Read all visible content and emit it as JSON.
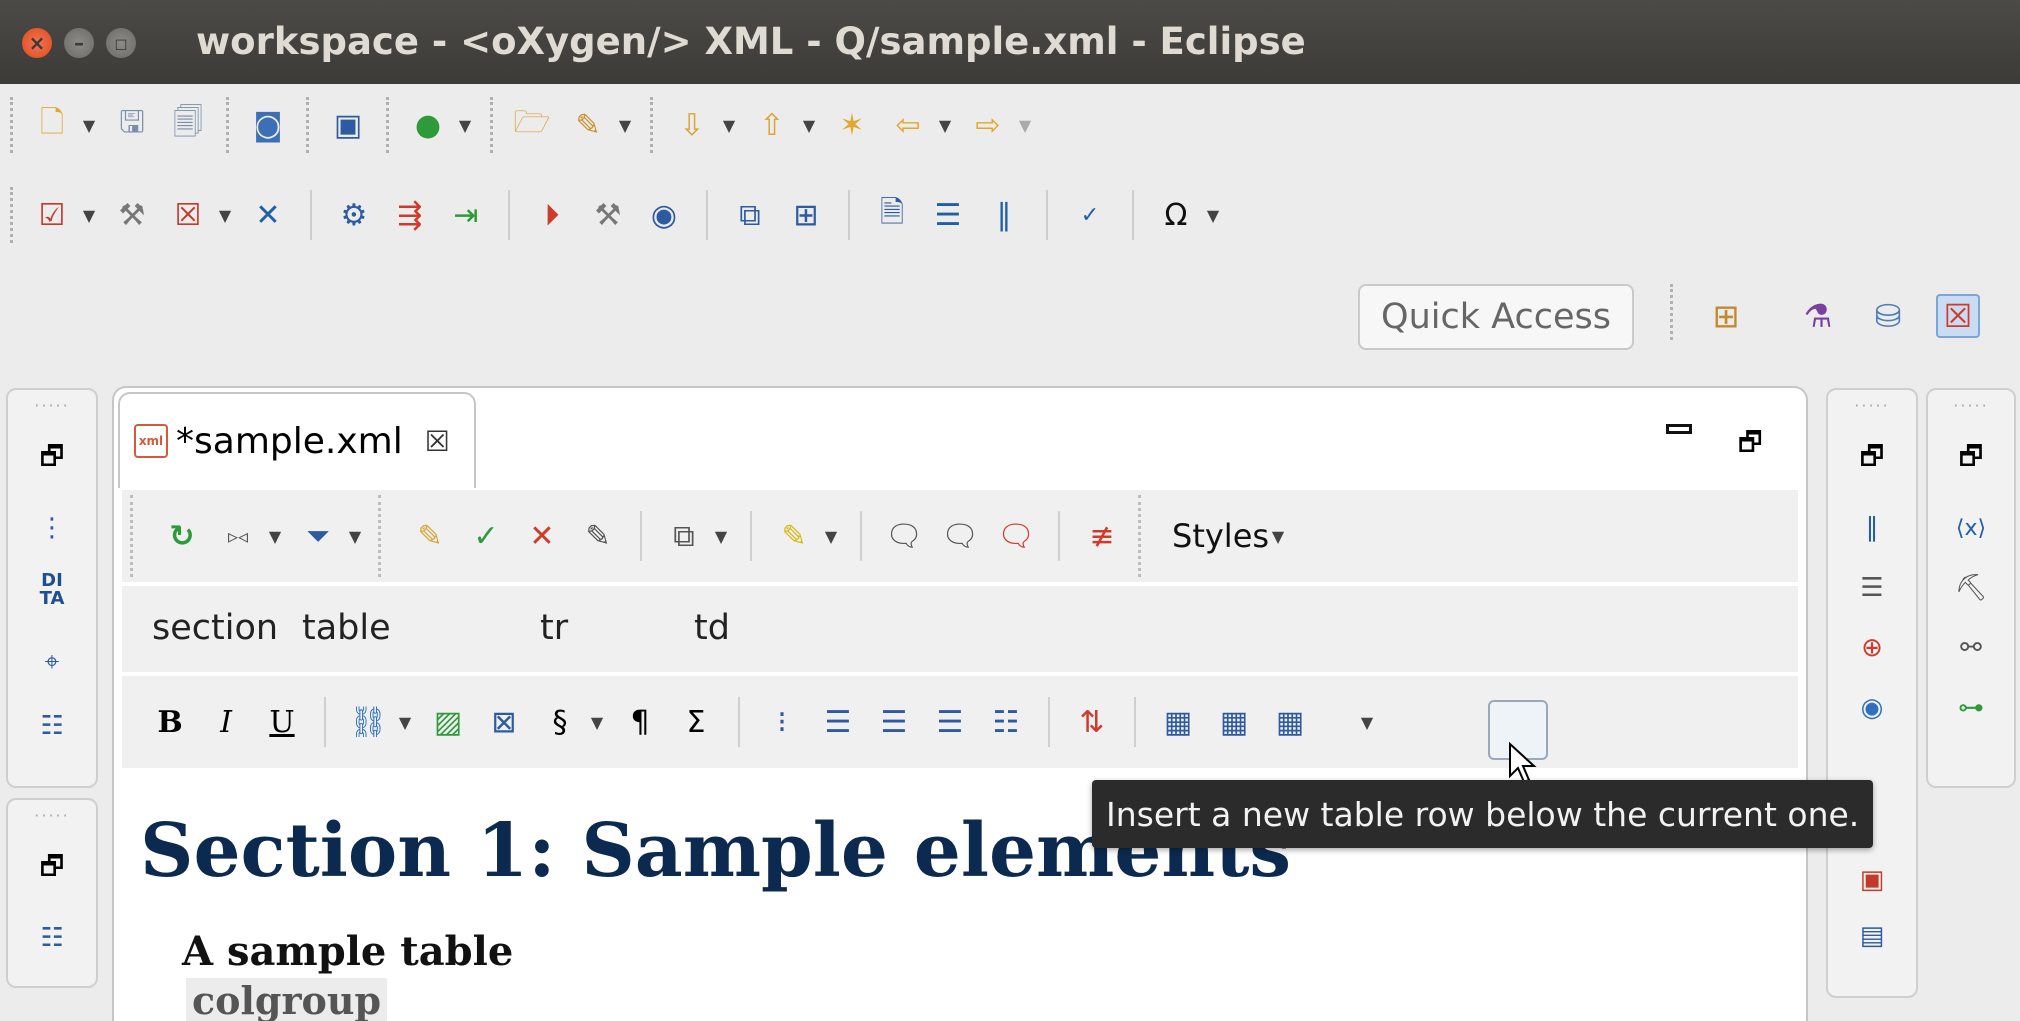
{
  "window": {
    "title": "workspace - <oXygen/> XML - Q/sample.xml - Eclipse",
    "buttons": {
      "close": "×",
      "minimize": "–",
      "maximize": "◻"
    }
  },
  "toolbar_main": {
    "row1_icons": [
      "new-file-icon",
      "save-icon",
      "save-all-icon",
      "refresh-icon",
      "monitor-icon",
      "run-icon",
      "open-folder-icon",
      "pen-icon",
      "next-annotation-icon",
      "previous-annotation-icon",
      "last-edit-icon",
      "back-icon",
      "forward-icon"
    ],
    "row2_icons": [
      "validate-icon",
      "configure-icon",
      "validate-all-icon",
      "delete-icon",
      "xml-settings-icon",
      "transform-icon",
      "apply-icon",
      "run-transform-icon",
      "debug-icon",
      "run-debug-icon",
      "compare-icon",
      "diff-icon",
      "document-icon",
      "format-indent-icon",
      "comment-icon",
      "spell-check-icon"
    ],
    "omega": "Ω"
  },
  "quick_access": {
    "label": "Quick Access",
    "perspectives": [
      "open-perspective-icon",
      "debug-perspective-icon",
      "database-perspective-icon",
      "xml-perspective-icon"
    ]
  },
  "editor": {
    "tab_label": "*sample.xml",
    "tab_icon_text": "xml",
    "tab_close": "☒",
    "styles_label": "Styles",
    "breadcrumb": [
      "section",
      "table",
      "tr",
      "td"
    ],
    "format_glyphs": {
      "bold": "B",
      "italic": "I",
      "underline": "U",
      "section": "§",
      "pilcrow": "¶",
      "sigma": "Σ"
    },
    "tooltip": "Insert a new table row below the current one.",
    "content": {
      "section_title": "Section 1: Sample elements",
      "table_title": "A sample table",
      "colgroup": "colgroup"
    }
  },
  "left_trim": {
    "dita_label": "DI\nTA"
  },
  "colors": {
    "titlebar": "#3c3b37",
    "title_text": "#dfdbd2",
    "heading": "#0c2a4f",
    "tooltip_bg": "#2b2b2b"
  }
}
